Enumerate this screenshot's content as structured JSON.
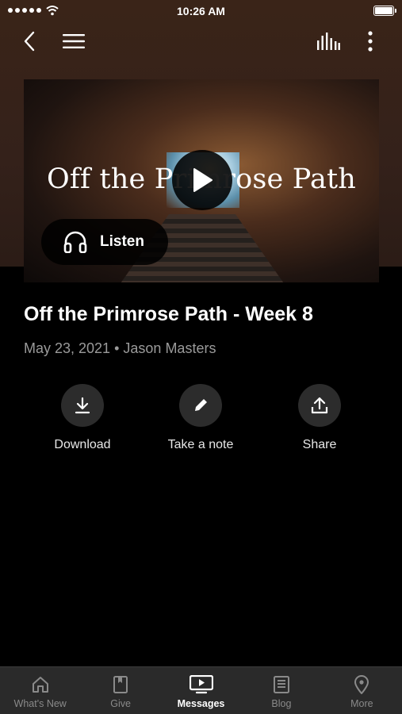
{
  "status_bar": {
    "time": "10:26 AM"
  },
  "nav": {
    "back": "back-icon",
    "menu": "menu-icon",
    "audio": "audio-bars-icon",
    "more": "more-vertical-icon"
  },
  "hero": {
    "title_art": "Off the Primrose Path",
    "listen_label": "Listen"
  },
  "message": {
    "title": "Off the Primrose Path - Week 8",
    "date": "May 23, 2021",
    "speaker": "Jason Masters"
  },
  "actions": [
    {
      "label": "Download",
      "icon": "download-icon"
    },
    {
      "label": "Take a note",
      "icon": "pencil-icon"
    },
    {
      "label": "Share",
      "icon": "share-icon"
    }
  ],
  "tabs": [
    {
      "label": "What's New",
      "icon": "home-icon"
    },
    {
      "label": "Give",
      "icon": "book-icon"
    },
    {
      "label": "Messages",
      "icon": "tv-play-icon",
      "active": true
    },
    {
      "label": "Blog",
      "icon": "blog-icon"
    },
    {
      "label": "More",
      "icon": "location-pin-icon"
    }
  ],
  "colors": {
    "background": "#000000",
    "header": "#3a2418",
    "tabbar": "#2a2a2a",
    "muted": "#9a9a9a"
  }
}
